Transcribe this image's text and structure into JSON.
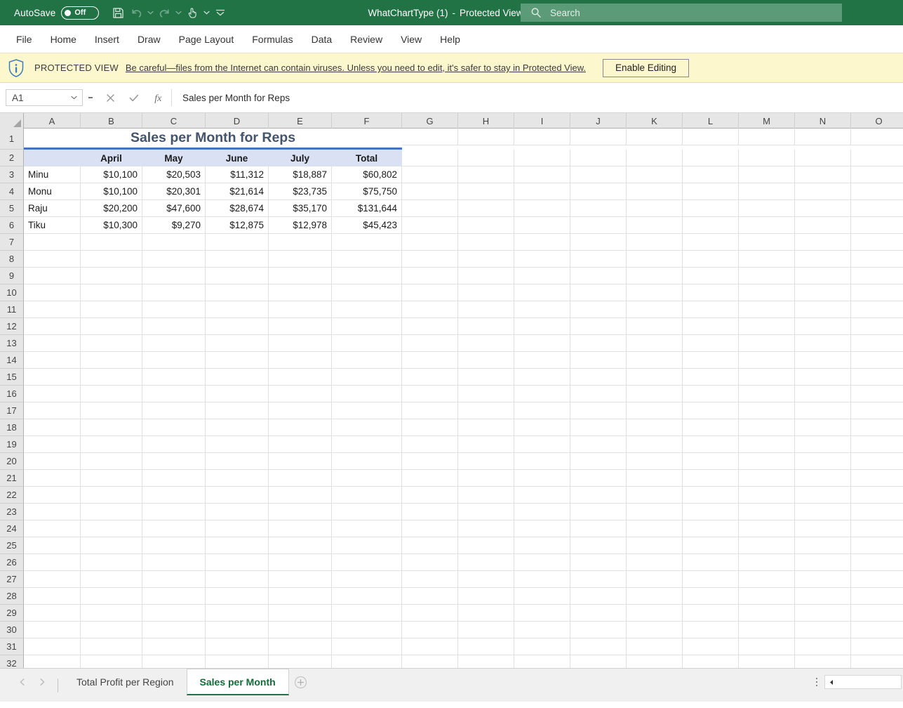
{
  "titlebar": {
    "autosave_label": "AutoSave",
    "autosave_state": "Off",
    "doc_name": "WhatChartType (1)",
    "doc_separator": "-",
    "doc_mode": "Protected View",
    "qat": [
      {
        "name": "save-icon",
        "label": "Save"
      },
      {
        "name": "undo-icon",
        "label": "Undo"
      },
      {
        "name": "redo-icon",
        "label": "Redo"
      },
      {
        "name": "touch-mouse-mode-icon",
        "label": "Touch/Mouse Mode"
      },
      {
        "name": "customize-quick-access-toolbar-icon",
        "label": "Customize Quick Access Toolbar"
      }
    ],
    "search_placeholder": "Search"
  },
  "ribbon": {
    "tabs": [
      {
        "label": "File"
      },
      {
        "label": "Home"
      },
      {
        "label": "Insert"
      },
      {
        "label": "Draw"
      },
      {
        "label": "Page Layout"
      },
      {
        "label": "Formulas"
      },
      {
        "label": "Data"
      },
      {
        "label": "Review"
      },
      {
        "label": "View"
      },
      {
        "label": "Help"
      }
    ]
  },
  "protected_view": {
    "title": "PROTECTED VIEW",
    "message": "Be careful—files from the Internet can contain viruses. Unless you need to edit, it's safer to stay in Protected View.",
    "button_label": "Enable Editing"
  },
  "formula_bar": {
    "name_box_value": "A1",
    "cancel_label": "Cancel",
    "enter_label": "Enter",
    "insert_function_label": "Insert Function",
    "formula_value": "Sales per Month for Reps"
  },
  "grid": {
    "column_headers": [
      "A",
      "B",
      "C",
      "D",
      "E",
      "F",
      "G",
      "H",
      "I",
      "J",
      "K",
      "L",
      "M",
      "N",
      "O"
    ],
    "row_headers": [
      "1",
      "2",
      "3",
      "4",
      "5",
      "6",
      "7",
      "8",
      "9",
      "10",
      "11",
      "12",
      "13",
      "14",
      "15",
      "16",
      "17",
      "18",
      "19",
      "20",
      "21",
      "22",
      "23",
      "24",
      "25",
      "26",
      "27",
      "28",
      "29",
      "30",
      "31",
      "32"
    ],
    "sheet_title": "Sales per Month for Reps",
    "table_headers": [
      "",
      "April",
      "May",
      "June",
      "July",
      "Total"
    ],
    "rows": [
      {
        "name": "Minu",
        "values": [
          "$10,100",
          "$20,503",
          "$11,312",
          "$18,887",
          "$60,802"
        ]
      },
      {
        "name": "Monu",
        "values": [
          "$10,100",
          "$20,301",
          "$21,614",
          "$23,735",
          "$75,750"
        ]
      },
      {
        "name": "Raju",
        "values": [
          "$20,200",
          "$47,600",
          "$28,674",
          "$35,170",
          "$131,644"
        ]
      },
      {
        "name": "Tiku",
        "values": [
          "$10,300",
          "$9,270",
          "$12,875",
          "$12,978",
          "$45,423"
        ]
      }
    ]
  },
  "sheet_tabs": {
    "prev_label": "Previous Sheet",
    "next_label": "Next Sheet",
    "tabs": [
      {
        "label": "Total Profit per Region",
        "active": false
      },
      {
        "label": "Sales per Month",
        "active": true
      }
    ],
    "add_label": "New sheet"
  },
  "colors": {
    "brand_green": "#217346",
    "protected_bar": "#fdf7cd",
    "header_fill": "#d9e1f2",
    "title_text": "#44546a",
    "title_border": "#4472c4"
  }
}
